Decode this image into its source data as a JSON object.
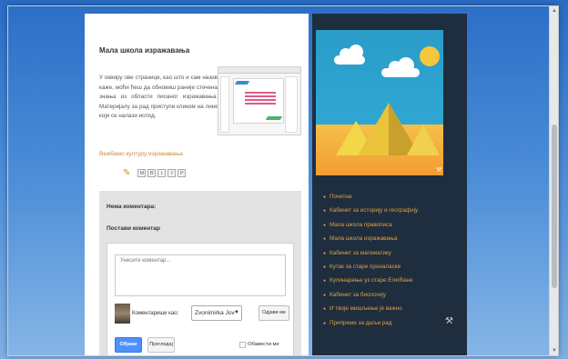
{
  "post": {
    "title": "Мала школа изражавања",
    "body": "У оквиру ове странице, као што и сам назив каже, моћи ћеш да обновиш раније стечена знања из области писаног изражавања. Материјалу за рад приступи кликом на линк који се налази испод.",
    "link_text": "Вежбамо културу изражавања",
    "share_buttons": [
      "M",
      "B",
      "t",
      "f",
      "P"
    ]
  },
  "comments": {
    "no_comments": "Нема коментара:",
    "post_comment": "Постави коментар",
    "placeholder": "Унесите коментар...",
    "comment_as": "Коментариши као:",
    "identity": "Zvonimirka Jov",
    "sign_out": "Одјави ме",
    "publish": "Објави",
    "preview": "Прегледај",
    "notify": "Обавести ме"
  },
  "sidebar": {
    "nav": [
      "Почетна",
      "Кабинет за историју и географију",
      "Мала школа правописа",
      "Мала школа изражавања",
      "Кабинет за математику",
      "Кутак за старе проналаске",
      "Кулинарење уз старе Египћане",
      "Кабинет за биологију",
      "И твоје мишљење је важно",
      "Припреме за даљи рад"
    ]
  },
  "colors": {
    "link": "#e0a040",
    "sidebar_bg": "#1f2e3e",
    "publish": "#4d90fe"
  }
}
